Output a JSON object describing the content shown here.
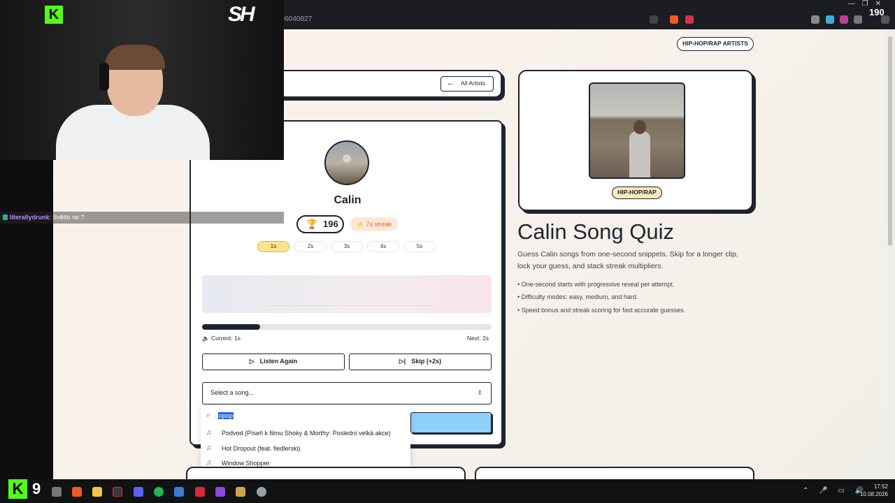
{
  "browser": {
    "url_fragment": "196040827",
    "badge_count": "190",
    "window_controls": [
      "—",
      "❐",
      "✕"
    ]
  },
  "page": {
    "genre_nav_label": "HIP-HOP/RAP ARTISTS",
    "all_artists_label": "All Artists",
    "artist_name": "Calin",
    "score": "196",
    "streak": "7x streak",
    "durations": [
      {
        "label": "1s",
        "active": true
      },
      {
        "label": "2s",
        "active": false
      },
      {
        "label": "3s",
        "active": false
      },
      {
        "label": "4s",
        "active": false
      },
      {
        "label": "5s",
        "active": false
      }
    ],
    "progress_fraction": 0.2,
    "current_label": "Current: 1s",
    "next_label": "Next: 2s",
    "listen_again_label": "Listen Again",
    "skip_label": "Skip (+2s)",
    "select_placeholder": "Select a song...",
    "genre_tag": "HIP-HOP/RAP",
    "quiz_title": "Calin Song Quiz",
    "quiz_description": "Guess Calin songs from one-second snippets. Skip for a longer clip, lock your guess, and stack streak multipliers.",
    "bullets": [
      "• One-second starts with progressive reveal per attempt.",
      "• Difficulty modes: easy, medium, and hard.",
      "• Speed bonus and streak scoring for fast accurate guesses."
    ]
  },
  "dropdown": {
    "search_value": "opop",
    "options": [
      "Podvod (Píseň k filmu Shoky & Morthy: Poslední velká akce)",
      "Hot Dropout (feat. fiedlerski)",
      "Window Shopper"
    ]
  },
  "chat": {
    "username": "literallydrunk",
    "message": ": Světlo ne ?"
  },
  "taskbar": {
    "kick_count": "9",
    "time": "17:52",
    "date": "10.08.2026"
  },
  "colors": {
    "accent_yellow": "#fbe48a",
    "accent_blue": "#8dd2fb",
    "kick_green": "#53fc18",
    "ink": "#1f2330"
  }
}
